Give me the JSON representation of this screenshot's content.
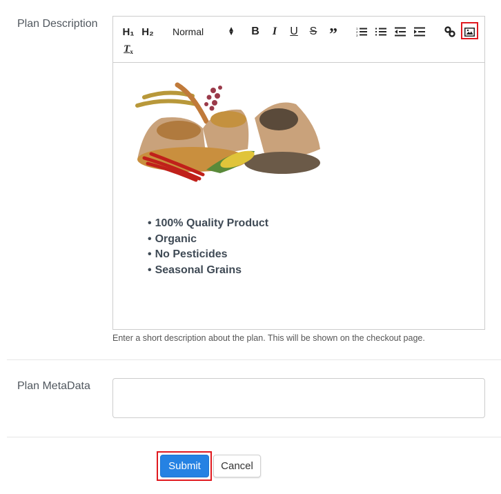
{
  "form": {
    "description_label": "Plan Description",
    "description_help": "Enter a short description about the plan. This will be shown on the checkout page.",
    "metadata_label": "Plan MetaData",
    "metadata_value": "",
    "submit_label": "Submit",
    "cancel_label": "Cancel"
  },
  "toolbar": {
    "h1": "H₁",
    "h2": "H₂",
    "format_select": "Normal",
    "buttons": [
      "header-1",
      "header-2",
      "format-select",
      "bold",
      "italic",
      "underline",
      "strike",
      "blockquote",
      "ordered-list",
      "bullet-list",
      "outdent",
      "indent",
      "link",
      "image",
      "clean"
    ]
  },
  "editor_content": {
    "image_alt": "grains-and-spices-image",
    "bullets": [
      "100% Quality Product",
      "Organic",
      "No Pesticides",
      "Seasonal Grains"
    ]
  },
  "colors": {
    "accent": "#2582e3",
    "highlight": "#e0181e"
  }
}
